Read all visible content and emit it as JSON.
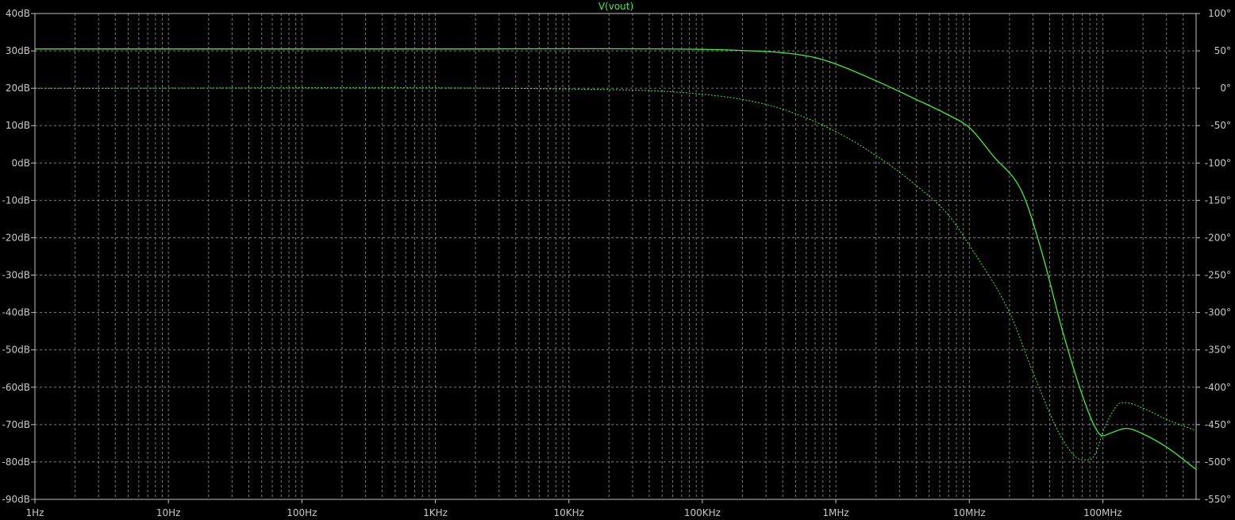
{
  "chart_data": {
    "type": "line",
    "title": "V(vout)",
    "x_scale": "log",
    "xlim": [
      1,
      500000000
    ],
    "x_ticks": [
      "1Hz",
      "10Hz",
      "100Hz",
      "1KHz",
      "10KHz",
      "100KHz",
      "1MHz",
      "10MHz",
      "100MHz"
    ],
    "y_left_ticks": [
      "40dB",
      "30dB",
      "20dB",
      "10dB",
      "0dB",
      "-10dB",
      "-20dB",
      "-30dB",
      "-40dB",
      "-50dB",
      "-60dB",
      "-70dB",
      "-80dB",
      "-90dB"
    ],
    "y_right_ticks": [
      "100°",
      "50°",
      "0°",
      "-50°",
      "-100°",
      "-150°",
      "-200°",
      "-250°",
      "-300°",
      "-350°",
      "-400°",
      "-450°",
      "-500°",
      "-550°"
    ],
    "ylim_left": [
      -90,
      40
    ],
    "ylim_right": [
      -550,
      100
    ],
    "grid": true,
    "trace_color": "#3cf03c",
    "series": [
      {
        "name": "V(vout) magnitude (dB)",
        "style": "solid",
        "x": [
          1,
          1000,
          100000,
          200000,
          400000,
          700000,
          1000000,
          2000000,
          4000000,
          7000000,
          10000000,
          15000000,
          25000000,
          35000000,
          50000000,
          70000000,
          90000000,
          100000000,
          110000000,
          150000000,
          200000000,
          300000000,
          500000000
        ],
        "y": [
          30.5,
          30.5,
          30.4,
          30.1,
          29.5,
          28.2,
          26.5,
          22.0,
          17.0,
          12.8,
          9.5,
          2.0,
          -8.0,
          -24.0,
          -45.0,
          -62.0,
          -71.5,
          -73.0,
          -72.5,
          -71.0,
          -72.5,
          -76.0,
          -82.0
        ]
      },
      {
        "name": "V(vout) phase (°)",
        "style": "dashed",
        "x": [
          1,
          10000,
          50000,
          100000,
          200000,
          400000,
          1000000,
          2000000,
          4000000,
          7000000,
          10000000,
          20000000,
          30000000,
          50000000,
          70000000,
          80000000,
          90000000,
          100000000,
          130000000,
          150000000,
          200000000,
          300000000,
          500000000
        ],
        "y": [
          0,
          -1,
          -4,
          -8,
          -15,
          -28,
          -58,
          -90,
          -130,
          -170,
          -210,
          -300,
          -380,
          -470,
          -497,
          -497,
          -485,
          -460,
          -423,
          -421,
          -428,
          -443,
          -458
        ]
      }
    ]
  }
}
